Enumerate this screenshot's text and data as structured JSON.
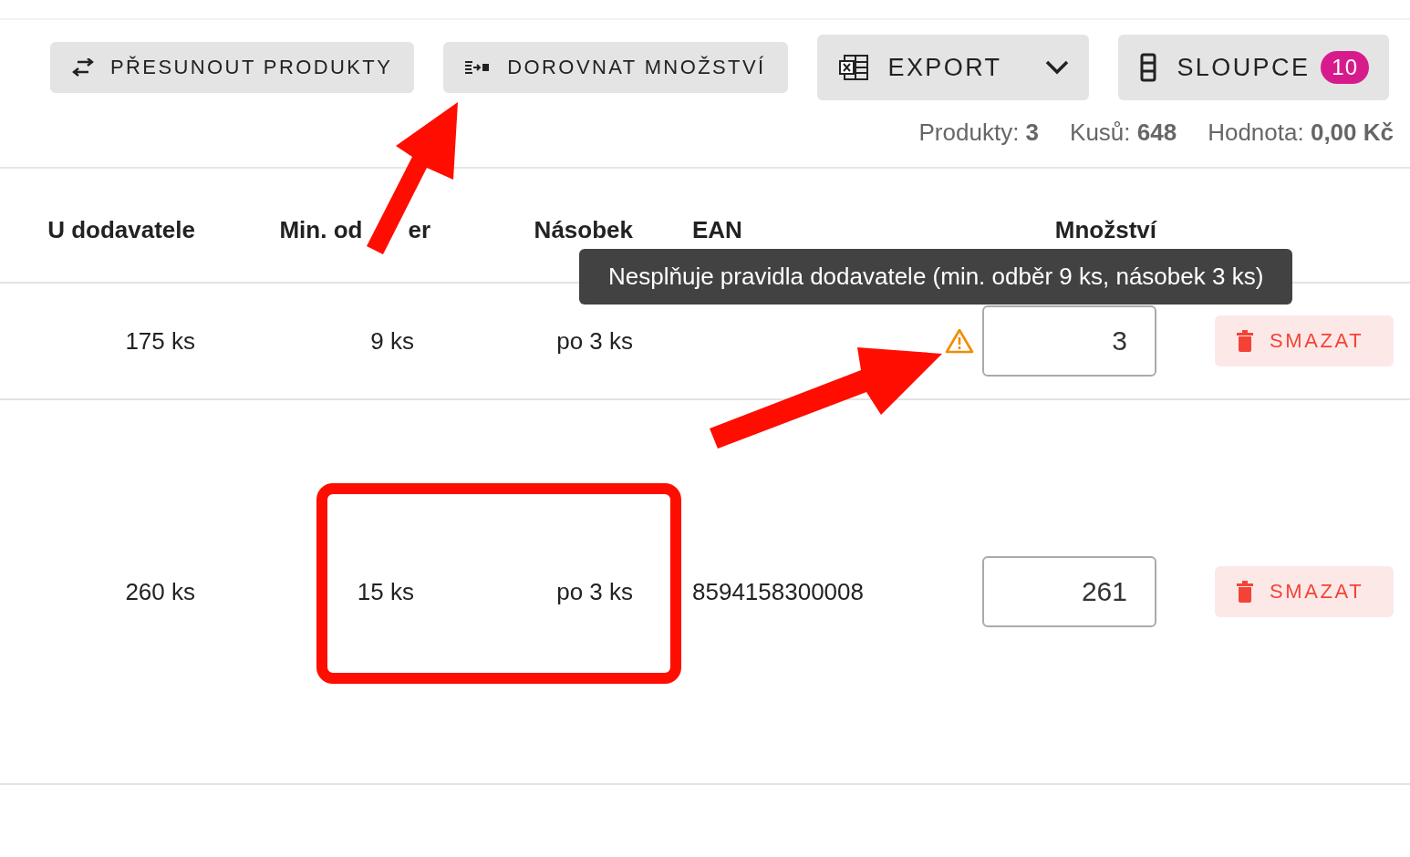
{
  "toolbar": [
    {
      "label": "PŘESUNOUT PRODUKTY",
      "kind": "plain"
    },
    {
      "label": "DOROVNAT MNOŽSTVÍ",
      "kind": "plain"
    },
    {
      "label": "EXPORT",
      "kind": "dropdown"
    },
    {
      "label": "SLOUPCE",
      "kind": "badge",
      "badge": "10"
    }
  ],
  "stats": [
    "Produkty: **3**",
    "Kusů: **648**",
    "Hodnota: **0,00 Kč**"
  ],
  "table": {
    "columns": [
      {
        "label": "U dodavatele"
      },
      {
        "label": "Min. od",
        "fragment": "er"
      },
      {
        "label": "Násobek"
      },
      {
        "label": "EAN"
      },
      {
        "label": "Množství"
      }
    ],
    "rows": [
      {
        "supplier_stock": "175 ks",
        "min_order": "9 ks",
        "multiple": "po 3 ks",
        "quantity": "3",
        "warning": true,
        "tooltip": "Nesplňuje pravidla dodavatele (min. odběr 9 ks, násobek 3 ks)",
        "action": "SMAZAT"
      },
      {
        "supplier_stock": "260 ks",
        "min_order": "15 ks",
        "multiple": "po 3 ks",
        "ean": "8594158300008",
        "quantity": "261",
        "warning": false,
        "action": "SMAZAT"
      }
    ]
  },
  "annotations": [
    {
      "kind": "arrow"
    },
    {
      "kind": "arrow"
    },
    {
      "kind": "highlight-box"
    }
  ]
}
